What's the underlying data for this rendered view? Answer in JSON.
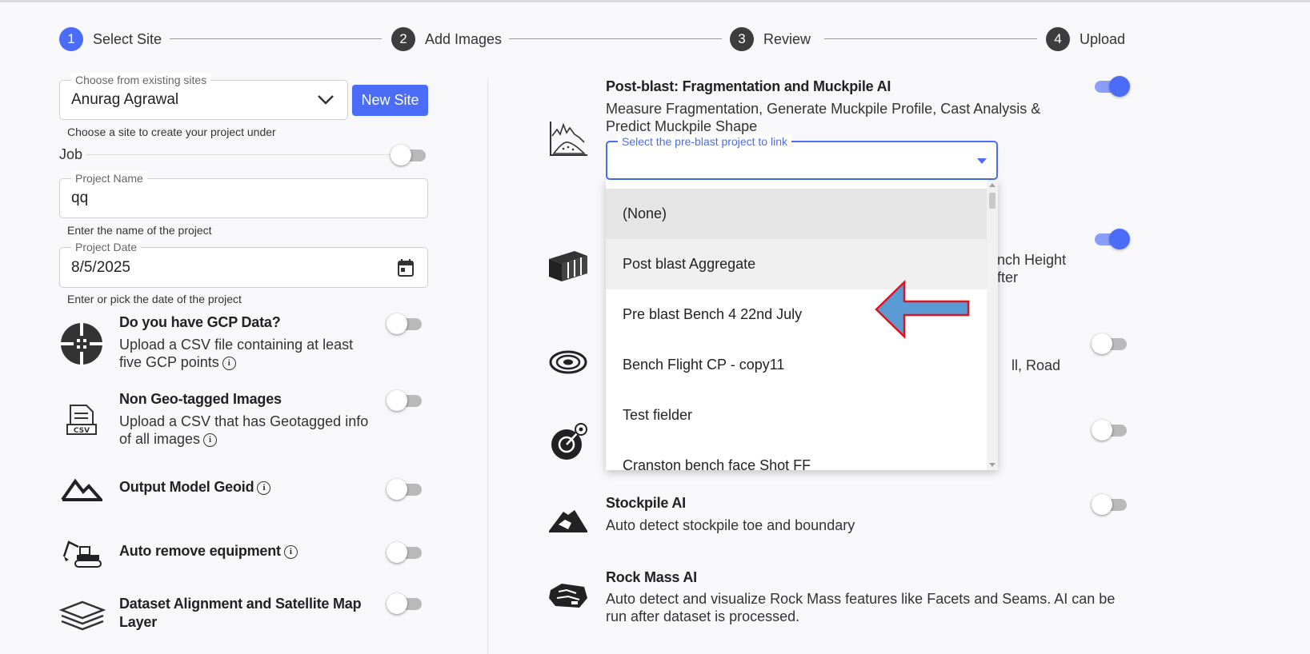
{
  "stepper": [
    {
      "num": "1",
      "label": "Select Site"
    },
    {
      "num": "2",
      "label": "Add Images"
    },
    {
      "num": "3",
      "label": "Review"
    },
    {
      "num": "4",
      "label": "Upload"
    }
  ],
  "site": {
    "legend": "Choose from existing sites",
    "value": "Anurag Agrawal",
    "helper": "Choose a site to create your project under",
    "new_site_label": "New Site"
  },
  "job": {
    "label": "Job",
    "on": false
  },
  "project_name": {
    "legend": "Project Name",
    "value": "qq",
    "helper": "Enter the name of the project"
  },
  "project_date": {
    "legend": "Project Date",
    "value": "8/5/2025",
    "helper": "Enter or pick the date of the project"
  },
  "left_options": [
    {
      "title": "Do you have GCP Data?",
      "desc1": "Upload a CSV file containing at least",
      "desc2": "five GCP points",
      "on": false
    },
    {
      "title": "Non Geo-tagged Images",
      "desc1": "Upload a CSV that has Geotagged info",
      "desc2": "of all images",
      "csv_icon_text": "CSV",
      "on": false
    },
    {
      "title": "Output Model Geoid",
      "on": false
    },
    {
      "title": "Auto remove equipment",
      "on": false
    },
    {
      "title": "Dataset Alignment and Satellite Map",
      "title2": "Layer",
      "on": false
    }
  ],
  "right_options": {
    "post_blast": {
      "title": "Post-blast: Fragmentation and Muckpile AI",
      "desc1": "Measure Fragmentation, Generate Muckpile Profile, Cast Analysis &",
      "desc2": "Predict Muckpile Shape",
      "on": true
    },
    "bench": {
      "partial1": "ench Height",
      "partial2": "after",
      "on": true
    },
    "haul": {
      "partial1": "ll, Road",
      "on": false
    },
    "fourth": {
      "on": false
    },
    "stockpile": {
      "title": "Stockpile AI",
      "desc1": "Auto detect stockpile toe and boundary",
      "on": false
    },
    "rockmass": {
      "title": "Rock Mass AI",
      "desc1": "Auto detect and visualize Rock Mass features like Facets and Seams. AI can be",
      "desc2": "run after dataset is processed."
    }
  },
  "preblast_select": {
    "legend": "Select the pre-blast project to link",
    "options": [
      "(None)",
      "Post blast Aggregate",
      "Pre blast Bench 4 22nd July",
      "Bench Flight CP - copy11",
      "Test fielder",
      "Cranston bench face Shot FF"
    ]
  },
  "colors": {
    "accent": "#4a6cf7",
    "arrow_fill": "#5b9bd5",
    "arrow_stroke": "#e0141c"
  }
}
